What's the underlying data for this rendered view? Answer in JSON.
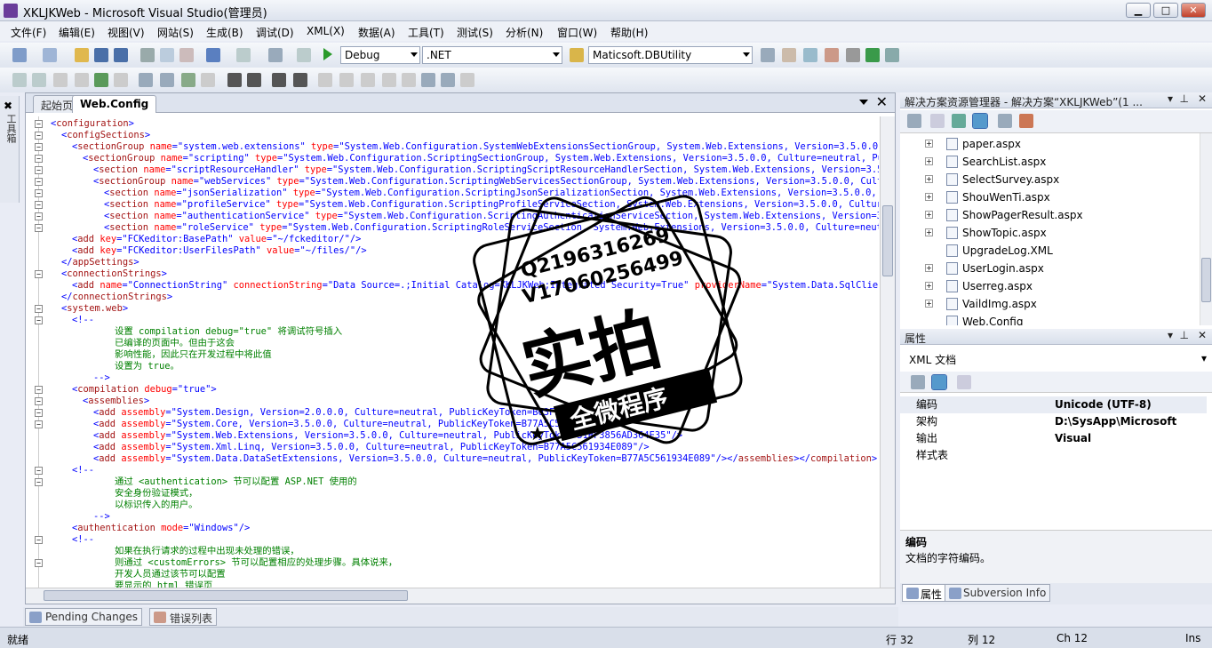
{
  "window": {
    "title": "XKLJKWeb - Microsoft Visual Studio(管理员)",
    "min_glyph": "▁",
    "max_glyph": "□",
    "close_glyph": "✕"
  },
  "menu": [
    "文件(F)",
    "编辑(E)",
    "视图(V)",
    "网站(S)",
    "生成(B)",
    "调试(D)",
    "XML(X)",
    "数据(A)",
    "工具(T)",
    "测试(S)",
    "分析(N)",
    "窗口(W)",
    "帮助(H)"
  ],
  "toolbar": {
    "config": "Debug",
    "platform": ".NET",
    "project": "Maticsoft.DBUtility"
  },
  "toolbox": {
    "label": "工具箱"
  },
  "editor": {
    "tabs": [
      "起始页",
      "Web.Config"
    ],
    "lines": [
      {
        "indent": 0,
        "html": "<span class='blue'>&lt;</span><span class='tag'>configuration</span><span class='blue'>&gt;</span>"
      },
      {
        "indent": 1,
        "html": "<span class='blue'>&lt;</span><span class='tag'>configSections</span><span class='blue'>&gt;</span>"
      },
      {
        "indent": 2,
        "html": "<span class='blue'>&lt;</span><span class='tag'>sectionGroup</span> <span class='attr'>name</span><span class='blue'>=\"system.web.extensions\"</span> <span class='attr'>type</span><span class='blue'>=\"System.Web.Configuration.SystemWebExtensionsSectionGroup, System.Web.Extensions, Version=3.5.0.0, Cult</span>"
      },
      {
        "indent": 3,
        "html": "<span class='blue'>&lt;</span><span class='tag'>sectionGroup</span> <span class='attr'>name</span><span class='blue'>=\"scripting\"</span> <span class='attr'>type</span><span class='blue'>=\"System.Web.Configuration.ScriptingSectionGroup, System.Web.Extensions, Version=3.5.0.0, Culture=neutral, PublicK</span>"
      },
      {
        "indent": 4,
        "html": "<span class='blue'>&lt;</span><span class='tag'>section</span> <span class='attr'>name</span><span class='blue'>=\"scriptResourceHandler\"</span> <span class='attr'>type</span><span class='blue'>=\"System.Web.Configuration.ScriptingScriptResourceHandlerSection, System.Web.Extensions, Version=3.5.0.0,</span>"
      },
      {
        "indent": 4,
        "html": "<span class='blue'>&lt;</span><span class='tag'>sectionGroup</span> <span class='attr'>name</span><span class='blue'>=\"webServices\"</span> <span class='attr'>type</span><span class='blue'>=\"System.Web.Configuration.ScriptingWebServicesSectionGroup, System.Web.Extensions, Version=3.5.0.0, Culture=n</span>"
      },
      {
        "indent": 5,
        "html": "<span class='blue'>&lt;</span><span class='tag'>section</span> <span class='attr'>name</span><span class='blue'>=\"jsonSerialization\"</span> <span class='attr'>type</span><span class='blue'>=\"System.Web.Configuration.ScriptingJsonSerializationSection, System.Web.Extensions, Version=3.5.0.0, Cultu</span>"
      },
      {
        "indent": 5,
        "html": "<span class='blue'>&lt;</span><span class='tag'>section</span> <span class='attr'>name</span><span class='blue'>=\"profileService\"</span> <span class='attr'>type</span><span class='blue'>=\"System.Web.Configuration.ScriptingProfileServiceSection, System.Web.Extensions, Version=3.5.0.0, Culture=neu</span>"
      },
      {
        "indent": 5,
        "html": "<span class='blue'>&lt;</span><span class='tag'>section</span> <span class='attr'>name</span><span class='blue'>=\"authenticationService\"</span> <span class='attr'>type</span><span class='blue'>=\"System.Web.Configuration.ScriptingAuthenticationServiceSection, System.Web.Extensions, Version=3.5.0.0</span>"
      },
      {
        "indent": 5,
        "html": "<span class='blue'>&lt;</span><span class='tag'>section</span> <span class='attr'>name</span><span class='blue'>=\"roleService\"</span> <span class='attr'>type</span><span class='blue'>=\"System.Web.Configuration.ScriptingRoleServiceSection, System.Web.Extensions, Version=3.5.0.0, Culture=neutral,</span>"
      },
      {
        "indent": 2,
        "html": "<span class='blue'>&lt;</span><span class='tag'>add</span> <span class='attr'>key</span><span class='blue'>=\"FCKeditor:BasePath\"</span> <span class='attr'>value</span><span class='blue'>=\"~/fckeditor/\"/&gt;</span>"
      },
      {
        "indent": 2,
        "html": "<span class='blue'>&lt;</span><span class='tag'>add</span> <span class='attr'>key</span><span class='blue'>=\"FCKeditor:UserFilesPath\"</span> <span class='attr'>value</span><span class='blue'>=\"~/files/\"/&gt;</span>"
      },
      {
        "indent": 1,
        "html": "<span class='blue'>&lt;/</span><span class='tag'>appSettings</span><span class='blue'>&gt;</span>"
      },
      {
        "indent": 1,
        "html": "<span class='blue'>&lt;</span><span class='tag'>connectionStrings</span><span class='blue'>&gt;</span>"
      },
      {
        "indent": 2,
        "html": "<span class='blue'>&lt;</span><span class='tag'>add</span> <span class='attr'>name</span><span class='blue'>=\"ConnectionString\"</span> <span class='attr'>connectionString</span><span class='blue'>=\"Data Source=.;Initial Catalog=XKLJKWeb;Integrated Security=True\"</span> <span class='attr'>providerName</span><span class='blue'>=\"System.Data.SqlClient\"/&gt;</span>"
      },
      {
        "indent": 1,
        "html": "<span class='blue'>&lt;/</span><span class='tag'>connectionStrings</span><span class='blue'>&gt;</span>"
      },
      {
        "indent": 1,
        "html": "<span class='blue'>&lt;</span><span class='tag'>system.web</span><span class='blue'>&gt;</span>"
      },
      {
        "indent": 2,
        "html": "<span class='blue'>&lt;!--</span>"
      },
      {
        "indent": 6,
        "html": "<span class='cmt'>设置 compilation debug=\"true\" 将调试符号插入</span>"
      },
      {
        "indent": 6,
        "html": "<span class='cmt'>已编译的页面中。但由于这会</span>"
      },
      {
        "indent": 6,
        "html": "<span class='cmt'>影响性能，因此只在开发过程中将此值</span>"
      },
      {
        "indent": 6,
        "html": "<span class='cmt'>设置为 true。</span>"
      },
      {
        "indent": 4,
        "html": "<span class='blue'>--&gt;</span>"
      },
      {
        "indent": 2,
        "html": "<span class='blue'>&lt;</span><span class='tag'>compilation</span> <span class='attr'>debug</span><span class='blue'>=\"true\"&gt;</span>"
      },
      {
        "indent": 3,
        "html": "<span class='blue'>&lt;</span><span class='tag'>assemblies</span><span class='blue'>&gt;</span>"
      },
      {
        "indent": 4,
        "html": "<span class='blue'>&lt;</span><span class='tag'>add</span> <span class='attr'>assembly</span><span class='blue'>=\"System.Design, Version=2.0.0.0, Culture=neutral, PublicKeyToken=B03F5F7</span>"
      },
      {
        "indent": 4,
        "html": "<span class='blue'>&lt;</span><span class='tag'>add</span> <span class='attr'>assembly</span><span class='blue'>=\"System.Core, Version=3.5.0.0, Culture=neutral, PublicKeyToken=B77A5C5619</span>"
      },
      {
        "indent": 4,
        "html": "<span class='blue'>&lt;</span><span class='tag'>add</span> <span class='attr'>assembly</span><span class='blue'>=\"System.Web.Extensions, Version=3.5.0.0, Culture=neutral, PublicKeyToken=31BF3856AD364E35\"/&gt;</span>"
      },
      {
        "indent": 4,
        "html": "<span class='blue'>&lt;</span><span class='tag'>add</span> <span class='attr'>assembly</span><span class='blue'>=\"System.Xml.Linq, Version=3.5.0.0, Culture=neutral, PublicKeyToken=B77A5C561934E089\"/&gt;</span>"
      },
      {
        "indent": 4,
        "html": "<span class='blue'>&lt;</span><span class='tag'>add</span> <span class='attr'>assembly</span><span class='blue'>=\"System.Data.DataSetExtensions, Version=3.5.0.0, Culture=neutral, PublicKeyToken=B77A5C561934E089\"/&gt;&lt;/</span><span class='tag'>assemblies</span><span class='blue'>&gt;&lt;/</span><span class='tag'>compilation</span><span class='blue'>&gt;</span>"
      },
      {
        "indent": 2,
        "html": "<span class='blue'>&lt;!--</span>"
      },
      {
        "indent": 6,
        "html": "<span class='cmt'>通过 &lt;authentication&gt; 节可以配置 ASP.NET 使用的</span>"
      },
      {
        "indent": 6,
        "html": "<span class='cmt'>安全身份验证模式，</span>"
      },
      {
        "indent": 6,
        "html": "<span class='cmt'>以标识传入的用户。</span>"
      },
      {
        "indent": 4,
        "html": "<span class='blue'>--&gt;</span>"
      },
      {
        "indent": 2,
        "html": "<span class='blue'>&lt;</span><span class='tag'>authentication</span> <span class='attr'>mode</span><span class='blue'>=\"Windows\"/&gt;</span>"
      },
      {
        "indent": 2,
        "html": "<span class='blue'>&lt;!--</span>"
      },
      {
        "indent": 6,
        "html": "<span class='cmt'>如果在执行请求的过程中出现未处理的错误，</span>"
      },
      {
        "indent": 6,
        "html": "<span class='cmt'>则通过 &lt;customErrors&gt; 节可以配置相应的处理步骤。具体说来，</span>"
      },
      {
        "indent": 6,
        "html": "<span class='cmt'>开发人员通过该节可以配置</span>"
      },
      {
        "indent": 6,
        "html": "<span class='cmt'>要显示的 html 错误页</span>"
      }
    ]
  },
  "solution_explorer": {
    "title": "解决方案资源管理器 - 解决方案“XKLJKWeb”(1 ...",
    "items": [
      "paper.aspx",
      "SearchList.aspx",
      "SelectSurvey.aspx",
      "ShouWenTi.aspx",
      "ShowPagerResult.aspx",
      "ShowTopic.aspx",
      "UpgradeLog.XML",
      "UserLogin.aspx",
      "Userreg.aspx",
      "VaildImg.aspx",
      "Web.Config"
    ]
  },
  "properties": {
    "title": "属性",
    "object": "XML 文档",
    "rows": [
      {
        "k": "编码",
        "v": "Unicode (UTF-8)"
      },
      {
        "k": "架构",
        "v": "D:\\SysApp\\Microsoft Visual"
      },
      {
        "k": "输出",
        "v": ""
      },
      {
        "k": "样式表",
        "v": ""
      }
    ],
    "desc_title": "编码",
    "desc_text": "文档的字符编码。",
    "tabs": [
      "属性",
      "Subversion Info"
    ]
  },
  "bottom_tabs": [
    "Pending Changes",
    "错误列表"
  ],
  "status": {
    "ready": "就绪",
    "line": "行 32",
    "col": "列 12",
    "ch": "Ch 12",
    "mode": "Ins"
  },
  "watermark": {
    "qq": "Q2196316269",
    "vx": "V17060256499",
    "big": "实拍",
    "banner": "全微程序"
  },
  "colors": {
    "tag": "#a31515",
    "attr": "#ff0000",
    "value": "#0000ff",
    "comment": "#008000"
  }
}
